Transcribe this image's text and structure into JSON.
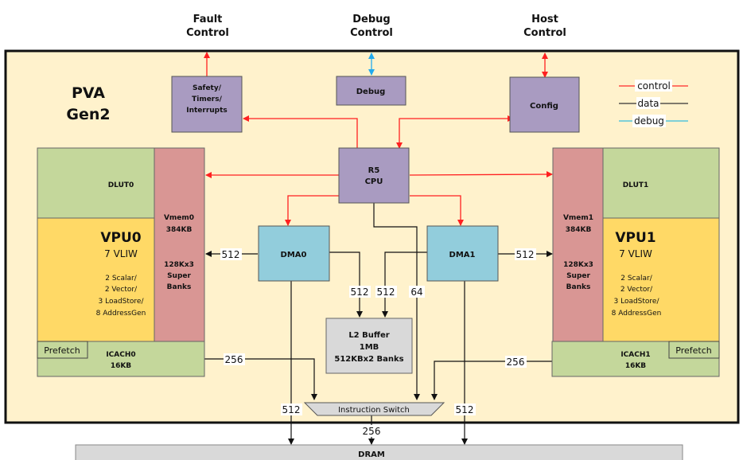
{
  "external": {
    "fault": [
      "Fault",
      "Control"
    ],
    "debug": [
      "Debug",
      "Control"
    ],
    "host": [
      "Host",
      "Control"
    ]
  },
  "title": [
    "PVA",
    "Gen2"
  ],
  "legend": {
    "control": {
      "label": "control",
      "color": "#ff2a2a"
    },
    "data": {
      "label": "data",
      "color": "#333333"
    },
    "debug": {
      "label": "debug",
      "color": "#33aadd"
    }
  },
  "blocks": {
    "safety": [
      "Safety/",
      "Timers/",
      "Interrupts"
    ],
    "debug": "Debug",
    "config": "Config",
    "cpu": [
      "R5",
      "CPU"
    ],
    "dma0": "DMA0",
    "dma1": "DMA1",
    "l2": [
      "L2 Buffer",
      "1MB",
      "512KBx2  Banks"
    ],
    "instruction_switch": "Instruction Switch",
    "dram": "DRAM"
  },
  "vpu0": {
    "dlut": "DLUT0",
    "name": "VPU0",
    "vliw": "7 VLIW",
    "units": [
      "2 Scalar/",
      "2 Vector/",
      "3 LoadStore/",
      "8 AddressGen"
    ],
    "vmem": [
      "Vmem0",
      "384KB",
      "128Kx3",
      "Super",
      "Banks"
    ],
    "prefetch": "Prefetch",
    "icache": [
      "ICACH0",
      "16KB"
    ]
  },
  "vpu1": {
    "dlut": "DLUT1",
    "name": "VPU1",
    "vliw": "7 VLIW",
    "units": [
      "2 Scalar/",
      "2 Vector/",
      "3 LoadStore/",
      "8 AddressGen"
    ],
    "vmem": [
      "Vmem1",
      "384KB",
      "128Kx3",
      "Super",
      "Banks"
    ],
    "prefetch": "Prefetch",
    "icache": [
      "ICACH1",
      "16KB"
    ]
  },
  "bus_widths": {
    "dma0_vmem0": "512",
    "dma1_vmem1": "512",
    "dma0_l2": "512",
    "dma1_l2": "512",
    "cpu_switch": "64",
    "icache0_switch": "256",
    "icache1_switch": "256",
    "dma0_dram": "512",
    "dma1_dram": "512",
    "switch_dram": "256"
  },
  "colors": {
    "background": "#fff2cc",
    "purple": "#a99bc1",
    "blue": "#92cddc",
    "green": "#c4d79b",
    "yellow": "#ffd966",
    "vmem": "#d99694",
    "gray": "#d9d9d9"
  }
}
